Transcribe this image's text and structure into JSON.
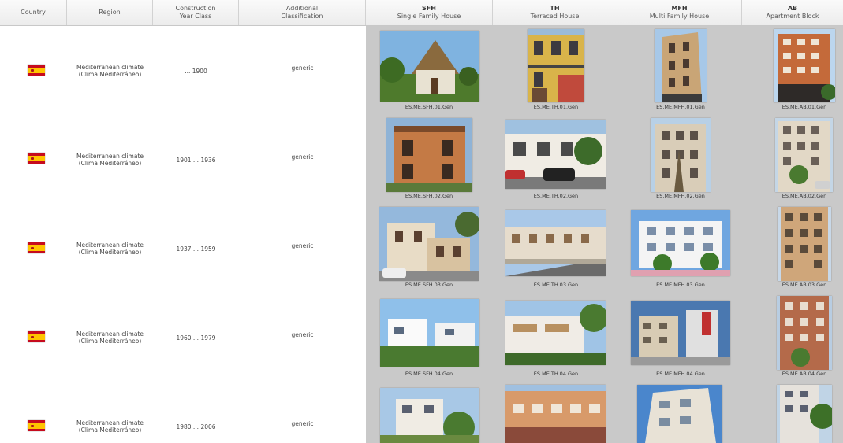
{
  "header": {
    "country": "Country",
    "region": "Region",
    "construction": [
      "Construction",
      "Year Class"
    ],
    "additional": [
      "Additional",
      "Classification"
    ],
    "types": [
      {
        "code": "SFH",
        "name": "Single Family House"
      },
      {
        "code": "TH",
        "name": "Terraced House"
      },
      {
        "code": "MFH",
        "name": "Multi Family House"
      },
      {
        "code": "AB",
        "name": "Apartment Block"
      }
    ]
  },
  "rows": [
    {
      "region": [
        "Mediterranean climate",
        "(Clima Mediterráneo)"
      ],
      "years": "... 1900",
      "classification": "generic",
      "codes": [
        "ES.ME.SFH.01.Gen",
        "ES.ME.TH.01.Gen",
        "ES.ME.MFH.01.Gen",
        "ES.ME.AB.01.Gen"
      ]
    },
    {
      "region": [
        "Mediterranean climate",
        "(Clima Mediterráneo)"
      ],
      "years": "1901 ... 1936",
      "classification": "generic",
      "codes": [
        "ES.ME.SFH.02.Gen",
        "ES.ME.TH.02.Gen",
        "ES.ME.MFH.02.Gen",
        "ES.ME.AB.02.Gen"
      ]
    },
    {
      "region": [
        "Mediterranean climate",
        "(Clima Mediterráneo)"
      ],
      "years": "1937 ... 1959",
      "classification": "generic",
      "codes": [
        "ES.ME.SFH.03.Gen",
        "ES.ME.TH.03.Gen",
        "ES.ME.MFH.03.Gen",
        "ES.ME.AB.03.Gen"
      ]
    },
    {
      "region": [
        "Mediterranean climate",
        "(Clima Mediterráneo)"
      ],
      "years": "1960 ... 1979",
      "classification": "generic",
      "codes": [
        "ES.ME.SFH.04.Gen",
        "ES.ME.TH.04.Gen",
        "ES.ME.MFH.04.Gen",
        "ES.ME.AB.04.Gen"
      ]
    },
    {
      "region": [
        "Mediterranean climate",
        "(Clima Mediterráneo)"
      ],
      "years": "1980 ... 2006",
      "classification": "generic",
      "codes": []
    }
  ],
  "flag_icon": "spain-flag-icon",
  "colors": {
    "band": "#c9c9c9",
    "header_bg": "#ececec"
  }
}
